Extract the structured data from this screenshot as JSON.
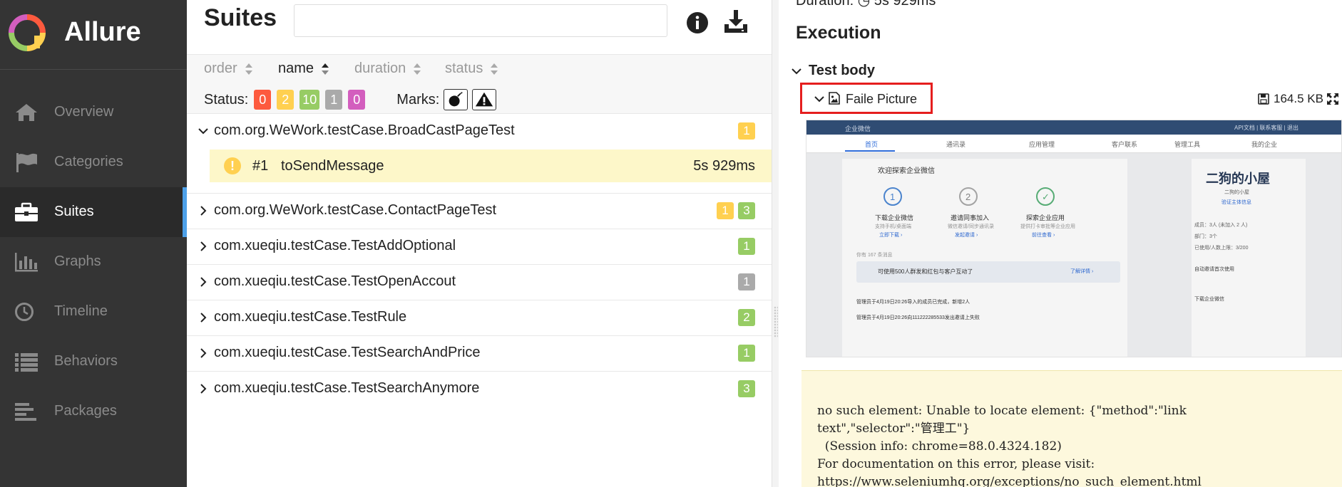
{
  "app": {
    "title": "Allure"
  },
  "colors": {
    "sidebar_bg": "#343434",
    "active_accent": "#4da0e8",
    "failed": "#fd5a3e",
    "broken": "#ffd050",
    "passed": "#97cc64",
    "skipped": "#aaaaaa",
    "unknown": "#d35ebe",
    "highlight_box": "#e51e1e"
  },
  "sidebar": {
    "items": [
      {
        "label": "Overview",
        "icon": "home-icon",
        "active": false
      },
      {
        "label": "Categories",
        "icon": "flag-icon",
        "active": false
      },
      {
        "label": "Suites",
        "icon": "briefcase-icon",
        "active": true
      },
      {
        "label": "Graphs",
        "icon": "bar-chart-icon",
        "active": false
      },
      {
        "label": "Timeline",
        "icon": "clock-icon",
        "active": false
      },
      {
        "label": "Behaviors",
        "icon": "list-icon",
        "active": false
      },
      {
        "label": "Packages",
        "icon": "align-left-icon",
        "active": false
      }
    ]
  },
  "suites": {
    "title": "Suites",
    "search": {
      "value": "",
      "placeholder": ""
    },
    "sort": [
      {
        "label": "order",
        "active": false
      },
      {
        "label": "name",
        "active": true
      },
      {
        "label": "duration",
        "active": false
      },
      {
        "label": "status",
        "active": false
      }
    ],
    "status_label": "Status:",
    "status_counts": {
      "failed": "0",
      "broken": "2",
      "passed": "10",
      "skipped": "1",
      "unknown": "0"
    },
    "marks_label": "Marks:",
    "rows": [
      {
        "name": "com.org.WeWork.testCase.BroadCastPageTest",
        "expanded": true,
        "counts": [
          {
            "status": "broken",
            "value": "1"
          }
        ]
      },
      {
        "name": "com.org.WeWork.testCase.ContactPageTest",
        "expanded": false,
        "counts": [
          {
            "status": "broken",
            "value": "1"
          },
          {
            "status": "passed",
            "value": "3"
          }
        ]
      },
      {
        "name": "com.xueqiu.testCase.TestAddOptional",
        "expanded": false,
        "counts": [
          {
            "status": "passed",
            "value": "1"
          }
        ]
      },
      {
        "name": "com.xueqiu.testCase.TestOpenAccout",
        "expanded": false,
        "counts": [
          {
            "status": "skipped",
            "value": "1"
          }
        ]
      },
      {
        "name": "com.xueqiu.testCase.TestRule",
        "expanded": false,
        "counts": [
          {
            "status": "passed",
            "value": "2"
          }
        ]
      },
      {
        "name": "com.xueqiu.testCase.TestSearchAndPrice",
        "expanded": false,
        "counts": [
          {
            "status": "passed",
            "value": "1"
          }
        ]
      },
      {
        "name": "com.xueqiu.testCase.TestSearchAnymore",
        "expanded": false,
        "counts": [
          {
            "status": "passed",
            "value": "3"
          }
        ]
      }
    ],
    "selected_case": {
      "number": "#1",
      "name": "toSendMessage",
      "duration": "5s 929ms",
      "status": "broken",
      "status_glyph": "!"
    }
  },
  "detail": {
    "duration_text": "Duration: ◷ 5s 929ms",
    "execution_title": "Execution",
    "test_body_label": "Test body",
    "attachment": {
      "name": "Faile Picture",
      "size": "164.5 KB"
    },
    "screenshot": {
      "brand": "企业微信",
      "top_links": "API文档 | 联系客服 | 退出",
      "tabs": [
        "首页",
        "通讯录",
        "应用管理",
        "客户联系",
        "管理工具",
        "我的企业"
      ],
      "card_title": "欢迎探索企业微信",
      "steps": [
        {
          "num": "1",
          "title": "下载企业微信",
          "sub": "支持手机/桌面端",
          "link": "立即下载 ›"
        },
        {
          "num": "2",
          "title": "邀请同事加入",
          "sub": "微信邀请/同步通讯录",
          "link": "发起邀请 ›"
        },
        {
          "num": "✓",
          "title": "探索企业应用",
          "sub": "提供打卡审批等企业应用",
          "link": "前往查看 ›"
        }
      ],
      "notice": "可使用500人群发和红包与客户互动了",
      "notice_link": "了解详情 ›",
      "message_count": "你有 167 条消息",
      "messages": [
        "管理员于4月19日20:26导入的成员已完成，新增2人",
        "管理员于4月19日20:26向111222285533发出邀请上失败"
      ],
      "company_name": "二狗的小屋",
      "company_sub": "二狗的小屋",
      "company_verify": "验证主体信息",
      "stats": [
        "成员：3人 (未加入 2 人)",
        "部门：3个",
        "已使用/人数上限：3/200"
      ],
      "side_items": [
        "自动邀请首次使用",
        "下载企业微信"
      ]
    },
    "error_message": "no such element: Unable to locate element: {\"method\":\"link\ntext\",\"selector\":\"管理工\"}\n  (Session info: chrome=88.0.4324.182)\nFor documentation on this error, please visit:\nhttps://www.seleniumhq.org/exceptions/no_such_element.html"
  }
}
